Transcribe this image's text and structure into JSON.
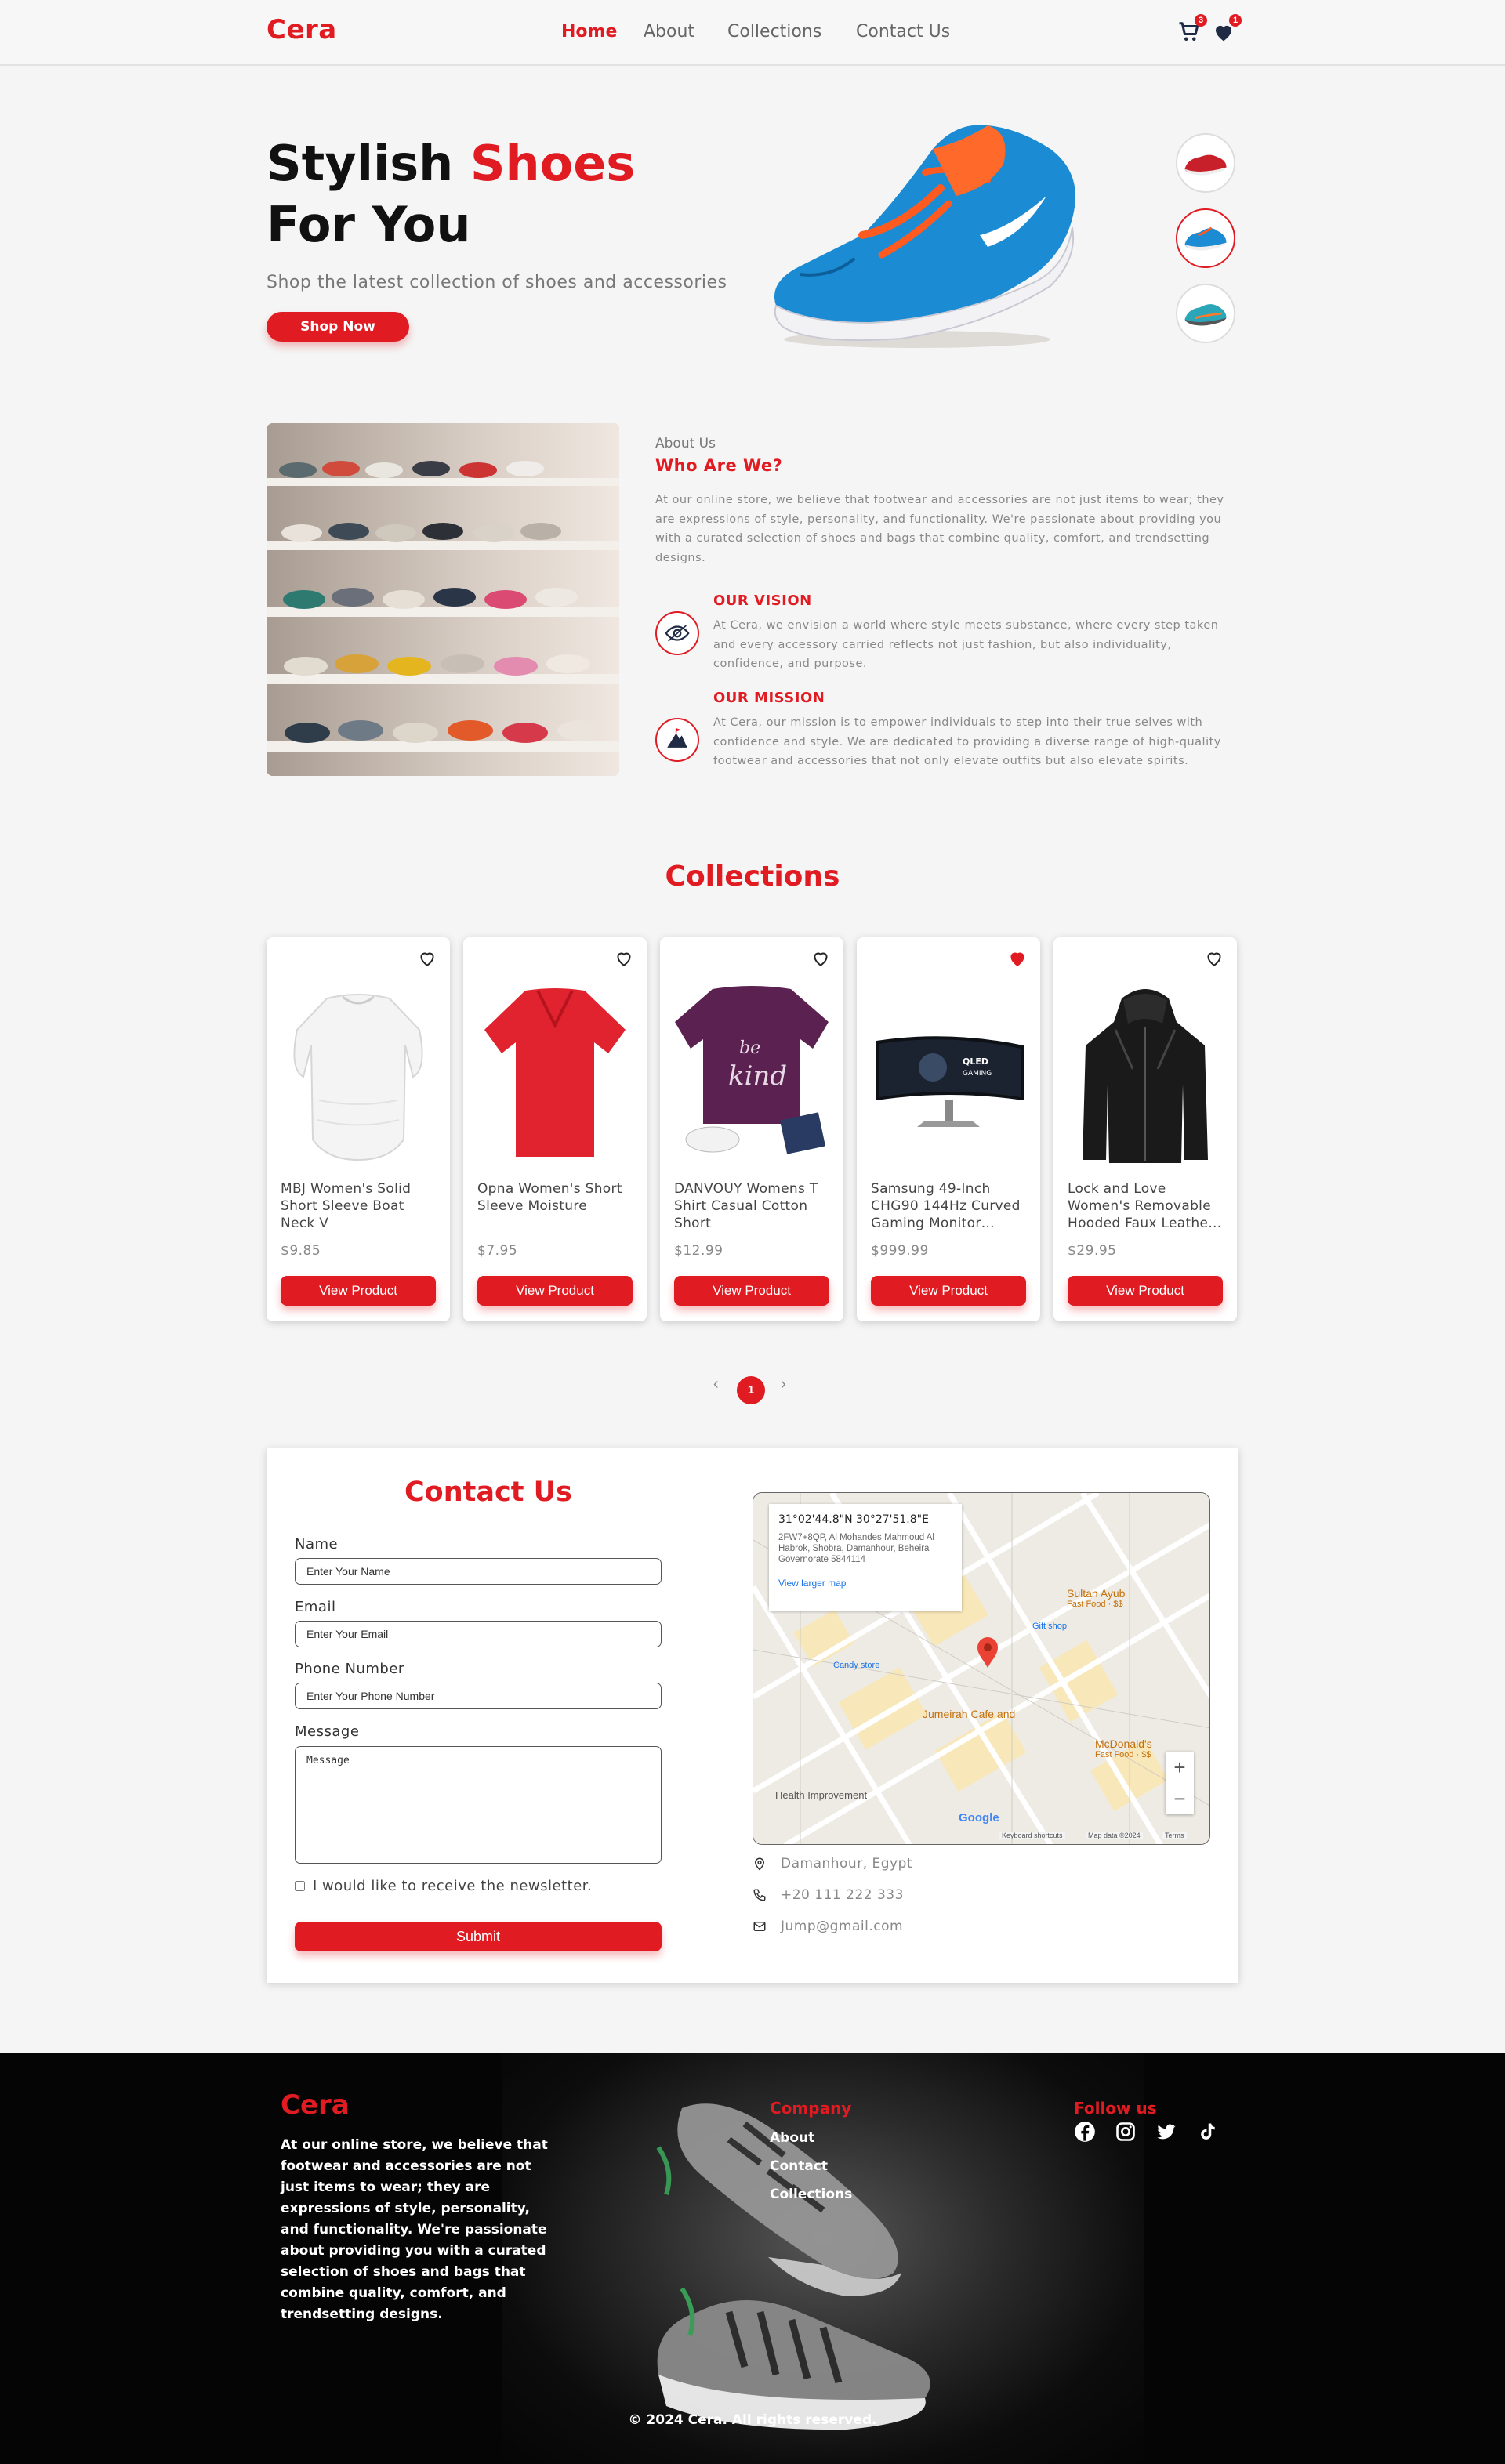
{
  "brand": {
    "name": "Cera",
    "accent_color": "#e01b22"
  },
  "nav": {
    "links": [
      "Home",
      "About",
      "Collections",
      "Contact Us"
    ],
    "active": "Home",
    "cart": {
      "icon": "cart-icon",
      "count": "3"
    },
    "wishlist": {
      "icon": "heart-icon",
      "count": "1"
    }
  },
  "hero": {
    "title_prefix": "Stylish",
    "title_highlight": "Shoes",
    "title_line2": "For You",
    "subtitle": "Shop the latest collection of shoes and accessories",
    "cta": "Shop Now",
    "thumbnails": [
      "red-shoe-thumb",
      "blue-orange-shoe-thumb",
      "teal-shoe-thumb"
    ],
    "selected_thumbnail": 1
  },
  "about": {
    "label": "About Us",
    "heading": "Who Are We?",
    "text": "At our online store, we believe that footwear and accessories are not just items to wear; they are expressions of style, personality, and functionality. We're passionate about providing you with a curated selection of shoes and bags that combine quality, comfort, and trendsetting designs.",
    "vision": {
      "title": "OUR VISION",
      "icon": "eye-icon",
      "text": "At Cera, we envision a world where style meets substance, where every step taken and every accessory carried reflects not just fashion, but also individuality, confidence, and purpose."
    },
    "mission": {
      "title": "OUR MISSION",
      "icon": "mountain-icon",
      "text": "At Cera, our mission is to empower individuals to step into their true selves with confidence and style. We are dedicated to providing a diverse range of high-quality footwear and accessories that not only elevate outfits but also elevate spirits."
    }
  },
  "collections": {
    "title": "Collections",
    "button_label": "View Product",
    "products": [
      {
        "name": "MBJ Women's Solid Short Sleeve Boat Neck V",
        "price": "$9.85",
        "favorited": false
      },
      {
        "name": "Opna Women's Short Sleeve Moisture",
        "price": "$7.95",
        "favorited": false
      },
      {
        "name": "DANVOUY Womens T Shirt Casual Cotton Short",
        "price": "$12.99",
        "favorited": false
      },
      {
        "name": "Samsung 49-Inch CHG90 144Hz Curved Gaming Monitor…",
        "price": "$999.99",
        "favorited": true
      },
      {
        "name": "Lock and Love Women's Removable Hooded Faux Leathe…",
        "price": "$29.95",
        "favorited": false
      }
    ],
    "pagination": {
      "prev": "‹",
      "current": "1",
      "next": "›"
    }
  },
  "contact": {
    "title": "Contact Us",
    "fields": {
      "name": {
        "label": "Name",
        "placeholder": "Enter Your Name"
      },
      "email": {
        "label": "Email",
        "placeholder": "Enter Your Email"
      },
      "phone": {
        "label": "Phone Number",
        "placeholder": "Enter Your Phone Number"
      },
      "message": {
        "label": "Message",
        "placeholder": "Message"
      }
    },
    "newsletter": "I would like to receive the newsletter.",
    "submit": "Submit",
    "map": {
      "coords": "31°02'44.8\"N 30°27'51.8\"E",
      "address": "2FW7+8QP, Al Mohandes Mahmoud Al Habrok, Shobra, Damanhour, Beheira Governorate 5844114",
      "link": "View larger map",
      "labels": {
        "sultan": "Sultan Ayub",
        "fastfood": "Fast Food · $$",
        "giftshop": "Gift shop",
        "candy": "Candy store",
        "jumeirah": "Jumeirah Cafe and",
        "mcdonalds": "McDonald's",
        "health": "Health Improvement",
        "google": "Google",
        "shortcuts": "Keyboard shortcuts",
        "mapdata": "Map data ©2024",
        "terms": "Terms"
      },
      "zoom_in": "+",
      "zoom_out": "−"
    },
    "info": {
      "location": "Damanhour, Egypt",
      "phone": "+20 111 222 333",
      "email": "Jump@gmail.com"
    }
  },
  "footer": {
    "logo": "Cera",
    "about": "At our online store, we believe that footwear and accessories are not just items to wear; they are expressions of style, personality, and functionality. We're passionate about providing you with a curated selection of shoes and bags that combine quality, comfort, and trendsetting designs.",
    "company_title": "Company",
    "company_links": [
      "About",
      "Contact",
      "Collections"
    ],
    "follow_title": "Follow us",
    "social": [
      "facebook-icon",
      "instagram-icon",
      "twitter-icon",
      "tiktok-icon"
    ],
    "copyright": "© 2024 Cera. All rights reserved."
  }
}
